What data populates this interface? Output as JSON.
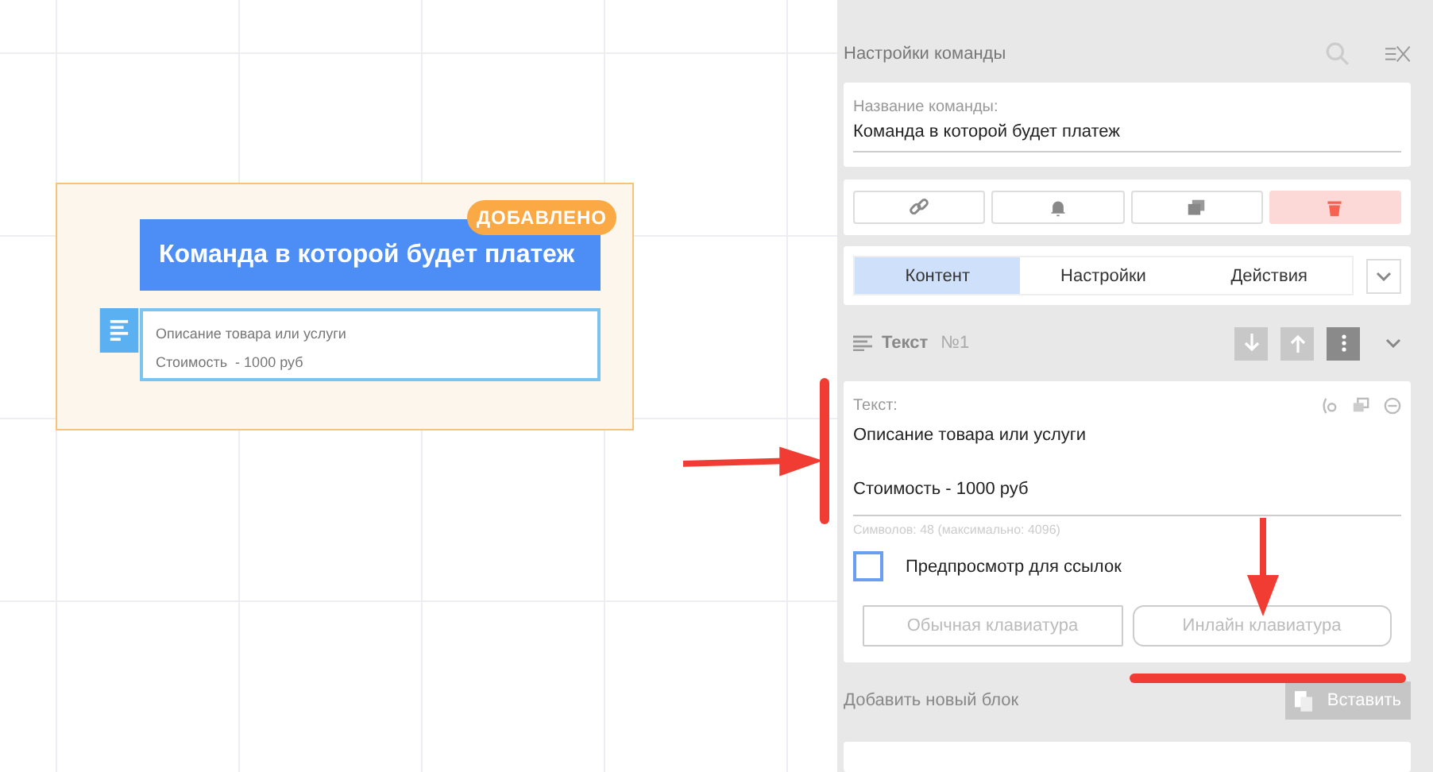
{
  "node": {
    "badge": "ДОБАВЛЕНО",
    "title": "Команда в которой будет платеж",
    "lines": [
      "Описание товара или услуги",
      "Стоимость  - 1000 руб"
    ]
  },
  "panel": {
    "title": "Настройки команды",
    "name_field": {
      "label": "Название команды:",
      "value": "Команда в которой будет платеж"
    },
    "actions": [
      {
        "kind": "link"
      },
      {
        "kind": "bell"
      },
      {
        "kind": "copy"
      },
      {
        "kind": "delete"
      }
    ],
    "tabs": [
      {
        "label": "Контент",
        "selected": true
      },
      {
        "label": "Настройки",
        "selected": false
      },
      {
        "label": "Действия",
        "selected": false
      }
    ],
    "block": {
      "title": "Текст",
      "number": "№1",
      "text_field": {
        "label": "Текст:",
        "lines": [
          "Описание товара или услуги",
          "Стоимость - 1000 руб"
        ]
      },
      "char_count": "Символов: 48 (максимально: 4096)",
      "checkbox": {
        "label": "Предпросмотр для ссылок",
        "checked": false
      },
      "keyboard_buttons": [
        "Обычная клавиатура",
        "Инлайн клавиатура"
      ]
    },
    "add_block": {
      "label": "Добавить новый блок",
      "paste_button": "Вставить"
    }
  }
}
